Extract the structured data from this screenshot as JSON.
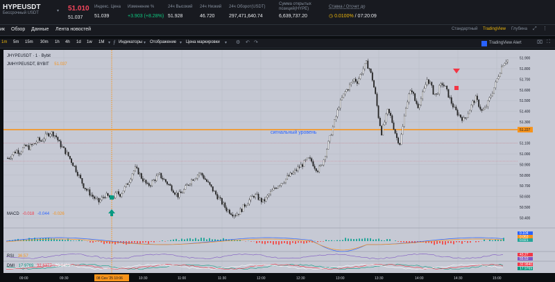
{
  "ticker": {
    "symbol": "HYPEUSDT",
    "contract_type": "Бессрочный USDT",
    "last_price": "51.010",
    "mark_price": "51.037",
    "index_label": "Индекс. Цена",
    "index_value": "51.039",
    "change_label": "Изменение %",
    "change_value": "+3.903 (+8.28%)",
    "high_label": "24ч Высокий",
    "high_value": "51.928",
    "low_label": "24ч Низкий",
    "low_value": "46.720",
    "turnover_label": "24ч Оборот(USDT)",
    "turnover_value": "297,471,640.74",
    "oi_label": "Сумма открытых позиций(HYPE)",
    "oi_value": "6,639,737.20",
    "funding_label": "Ставка / Отсчет до",
    "funding_rate": "0.0100%",
    "funding_countdown": "07:20:09"
  },
  "tabs": {
    "left": [
      "ик",
      "Обзор",
      "Данные",
      "Лента новостей"
    ],
    "right": [
      "Стандартный",
      "TradingView",
      "Глубина"
    ],
    "active_right": "TradingView"
  },
  "toolbar": {
    "intervals": [
      "1m",
      "5m",
      "15m",
      "30m",
      "1h",
      "4h",
      "1d",
      "1w",
      "1M"
    ],
    "active_interval": "1m",
    "indicators": "Индикаторы",
    "display": "Отображение",
    "price_type": "Цена маркировки",
    "alert": "TradingView Alert"
  },
  "legend": {
    "line1": "JHYPEUSDT · 1 · Bybit",
    "line2": "JMHYPEUSDT, BYBIT",
    "line2_value": "51.037"
  },
  "chart_data": {
    "type": "candlestick",
    "price_axis": [
      "51.900",
      "51.800",
      "51.700",
      "51.600",
      "51.500",
      "51.400",
      "51.300",
      "51.100",
      "51.000",
      "50.900",
      "50.800",
      "50.700",
      "50.600",
      "50.500",
      "50.400"
    ],
    "ylim": [
      50.35,
      51.95
    ],
    "time_axis": [
      "09:00",
      "09:30",
      "10:30",
      "11:00",
      "11:30",
      "12:00",
      "12:30",
      "13:00",
      "13:30",
      "14:00",
      "14:30",
      "15:00"
    ],
    "crosshair_time": "08 Сен '25  10:06",
    "signal_level": {
      "value": 51.227,
      "label": "сигнальный уровень",
      "color": "#f7931a"
    },
    "current_price_label": "51.227",
    "price_path": [
      50.96,
      50.98,
      51.01,
      51.03,
      51.02,
      51.05,
      51.07,
      51.06,
      51.08,
      51.1,
      51.13,
      51.12,
      51.15,
      51.18,
      51.2,
      51.19,
      51.16,
      51.1,
      51.06,
      51.02,
      50.98,
      50.93,
      50.88,
      50.82,
      50.76,
      50.7,
      50.66,
      50.63,
      50.6,
      50.57,
      50.55,
      50.58,
      50.61,
      50.6,
      50.58,
      50.6,
      50.63,
      50.62,
      50.66,
      50.7,
      50.75,
      50.82,
      50.86,
      50.83,
      50.78,
      50.74,
      50.7,
      50.72,
      50.75,
      50.78,
      50.8,
      50.77,
      50.74,
      50.71,
      50.68,
      50.64,
      50.61,
      50.63,
      50.66,
      50.7,
      50.74,
      50.77,
      50.79,
      50.82,
      50.8,
      50.76,
      50.72,
      50.68,
      50.64,
      50.6,
      50.56,
      50.52,
      50.48,
      50.46,
      50.44,
      50.43,
      50.45,
      50.48,
      50.52,
      50.55,
      50.58,
      50.61,
      50.6,
      50.57,
      50.55,
      50.58,
      50.62,
      50.65,
      50.68,
      50.71,
      50.73,
      50.75,
      50.78,
      50.8,
      50.82,
      50.85,
      50.88,
      50.9,
      50.93,
      50.95,
      50.93,
      50.88,
      50.85,
      50.88,
      50.95,
      51.05,
      51.15,
      51.25,
      51.35,
      51.45,
      51.52,
      51.58,
      51.62,
      51.66,
      51.7,
      51.68,
      51.74,
      51.8,
      51.85,
      51.8,
      51.7,
      51.55,
      51.35,
      51.2,
      51.3,
      51.4,
      51.35,
      51.25,
      51.15,
      51.1,
      51.25,
      51.45,
      51.55,
      51.6,
      51.5,
      51.45,
      51.52,
      51.6,
      51.7,
      51.66,
      51.58,
      51.55,
      51.62,
      51.66,
      51.62,
      51.55,
      51.48,
      51.42,
      51.38,
      51.35,
      51.32,
      51.36,
      51.42,
      51.48,
      51.52,
      51.46,
      51.4,
      51.42,
      51.48,
      51.55,
      51.62,
      51.7,
      51.78,
      51.85,
      51.88
    ]
  },
  "indicators": {
    "macd": {
      "label": "MACD",
      "v1": "-0.018",
      "v2": "-0.044",
      "v3": "-0.026",
      "axis": [
        "0.104",
        "0.063",
        "0.021"
      ]
    },
    "rsi": {
      "label": "RSI",
      "value": "36.57",
      "axis": [
        "43.27",
        "55.53"
      ]
    },
    "dmi": {
      "label": "DMI",
      "v1": "17.9769",
      "v2": "32.6377",
      "v3": "26.9481",
      "axis": [
        "32.9840",
        "17.9769"
      ]
    }
  }
}
